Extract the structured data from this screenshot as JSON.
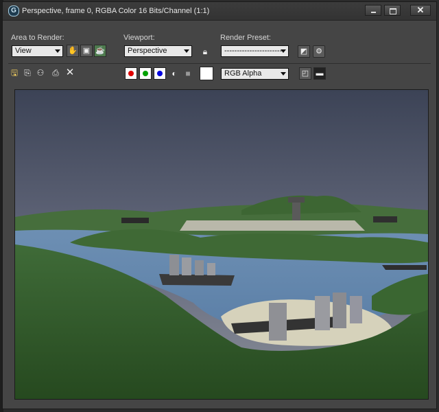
{
  "window": {
    "title": "Perspective, frame 0, RGBA Color 16 Bits/Channel (1:1)",
    "app_icon": "3ds-max-g-icon"
  },
  "toolbar": {
    "area_label": "Area to Render:",
    "area_value": "View",
    "viewport_label": "Viewport:",
    "viewport_value": "Perspective",
    "preset_label": "Render Preset:",
    "preset_value": "------------------------",
    "channel_value": "RGB Alpha"
  },
  "colors": {
    "red_channel": "#e00000",
    "green_channel": "#00a000",
    "blue_channel": "#0000e0",
    "background_swatch": "#ffffff",
    "window_bg": "#454545"
  },
  "render_scene": {
    "description_icons": [
      "island-terrain",
      "water",
      "ships",
      "airfield",
      "control-tower"
    ]
  }
}
